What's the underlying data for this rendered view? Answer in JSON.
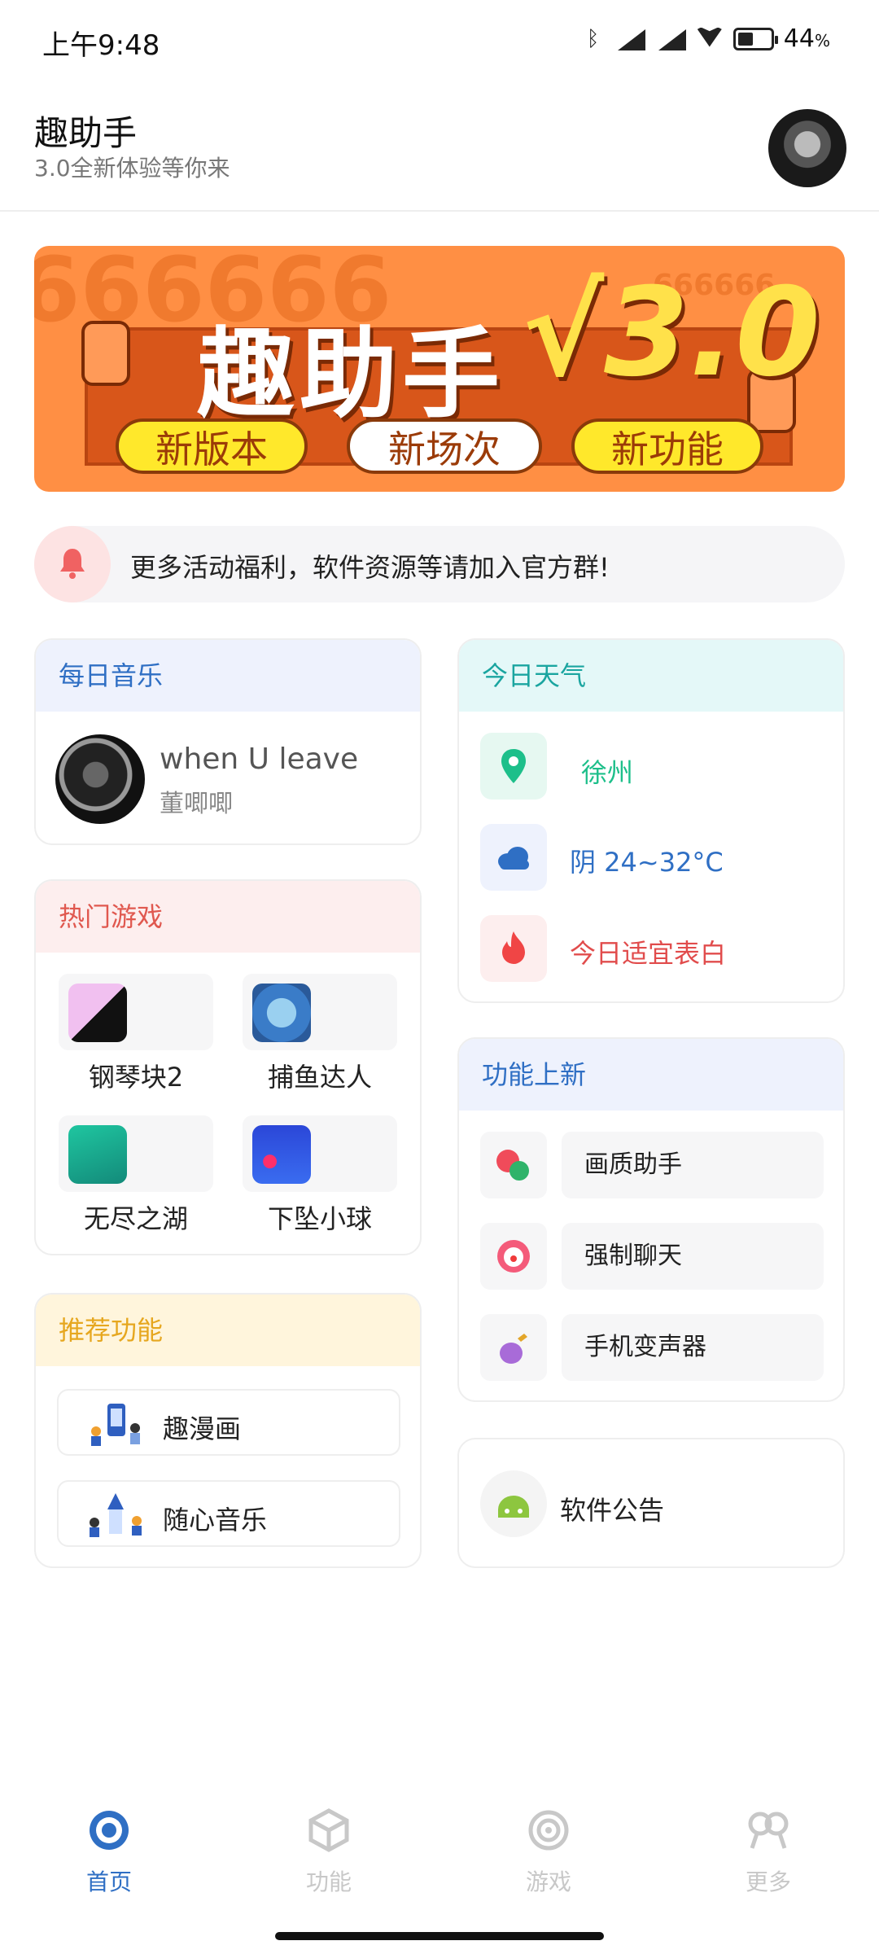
{
  "status": {
    "time": "上午9:48",
    "battery": "44",
    "battery_unit": "%"
  },
  "header": {
    "title": "趣助手",
    "subtitle": "3.0全新体验等你来"
  },
  "banner": {
    "title": "趣助手",
    "version": "√3.0",
    "pills": [
      "新版本",
      "新场次",
      "新功能"
    ],
    "bg_text": "666666",
    "bg_text_small": "666666"
  },
  "notice": {
    "text": "更多活动福利，软件资源等请加入官方群!"
  },
  "music_card": {
    "title": "每日音乐",
    "song": "when U leave",
    "artist": "董唧唧",
    "accent": "#2f6fc4",
    "head_bg": "#eef2fd"
  },
  "weather_card": {
    "title": "今日天气",
    "accent": "#1aa5a0",
    "head_bg": "#e4f8f8",
    "rows": [
      {
        "icon": "location-pin-icon",
        "text": "徐州",
        "color": "#1dbf8a"
      },
      {
        "icon": "cloud-icon",
        "text": "阴 24~32°C",
        "color": "#2f6fc4"
      },
      {
        "icon": "flame-icon",
        "text": "今日适宜表白",
        "color": "#e14c4c"
      }
    ]
  },
  "games_card": {
    "title": "热门游戏",
    "accent": "#e0584f",
    "head_bg": "#fdeeee",
    "items": [
      {
        "label": "钢琴块2",
        "icon": "piano-tiles-icon"
      },
      {
        "label": "捕鱼达人",
        "icon": "fish-game-icon"
      },
      {
        "label": "无尽之湖",
        "icon": "zigzag-game-icon"
      },
      {
        "label": "下坠小球",
        "icon": "falling-ball-icon"
      }
    ]
  },
  "features_card": {
    "title": "功能上新",
    "accent": "#2f6fc4",
    "head_bg": "#eef2fd",
    "items": [
      {
        "label": "画质助手",
        "icon": "balloon-icon"
      },
      {
        "label": "强制聊天",
        "icon": "clown-icon"
      },
      {
        "label": "手机变声器",
        "icon": "eggplant-icon"
      }
    ]
  },
  "recommend_card": {
    "title": "推荐功能",
    "accent": "#e6a71f",
    "head_bg": "#fff5dc",
    "items": [
      {
        "label": "趣漫画",
        "icon": "comic-illustration-icon"
      },
      {
        "label": "随心音乐",
        "icon": "music-illustration-icon"
      }
    ]
  },
  "announce_card": {
    "label": "软件公告",
    "icon": "android-icon"
  },
  "nav": {
    "items": [
      {
        "label": "首页",
        "icon": "home-target-icon",
        "active": true
      },
      {
        "label": "功能",
        "icon": "cube-icon",
        "active": false
      },
      {
        "label": "游戏",
        "icon": "game-swirl-icon",
        "active": false
      },
      {
        "label": "更多",
        "icon": "more-circles-icon",
        "active": false
      }
    ],
    "active_color": "#2f6fc4",
    "inactive_color": "#c8c8c8"
  }
}
